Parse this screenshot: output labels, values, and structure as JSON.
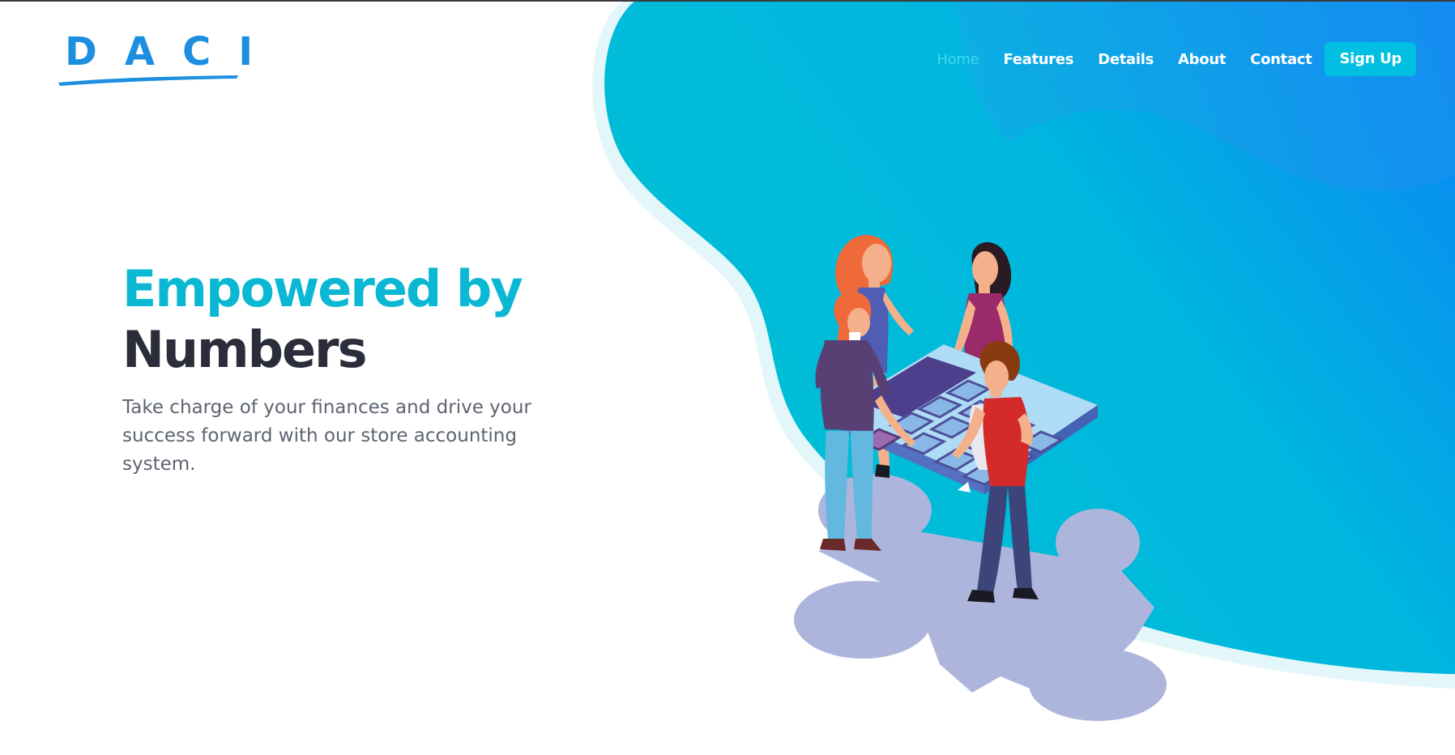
{
  "brand": {
    "logo_text": "DACI",
    "logo_color": "#1e8fe0"
  },
  "nav": {
    "items": [
      {
        "label": "Home",
        "active": true
      },
      {
        "label": "Features",
        "active": false
      },
      {
        "label": "Details",
        "active": false
      },
      {
        "label": "About",
        "active": false
      },
      {
        "label": "Contact",
        "active": false
      }
    ],
    "signup_label": "Sign Up"
  },
  "hero": {
    "title_line1": "Empowered by",
    "title_line2": "Numbers",
    "description": "Take charge of your finances and drive your success forward with our store accounting system."
  },
  "colors": {
    "accent": "#0ab8d4",
    "nav_active": "#3fd8ea",
    "button": "#00bfe0",
    "heading_dark": "#2b2d3a",
    "gradient_start": "#00c0d4",
    "gradient_end": "#0a84f0"
  },
  "illustration": {
    "icon": "team-calculator-illustration"
  }
}
